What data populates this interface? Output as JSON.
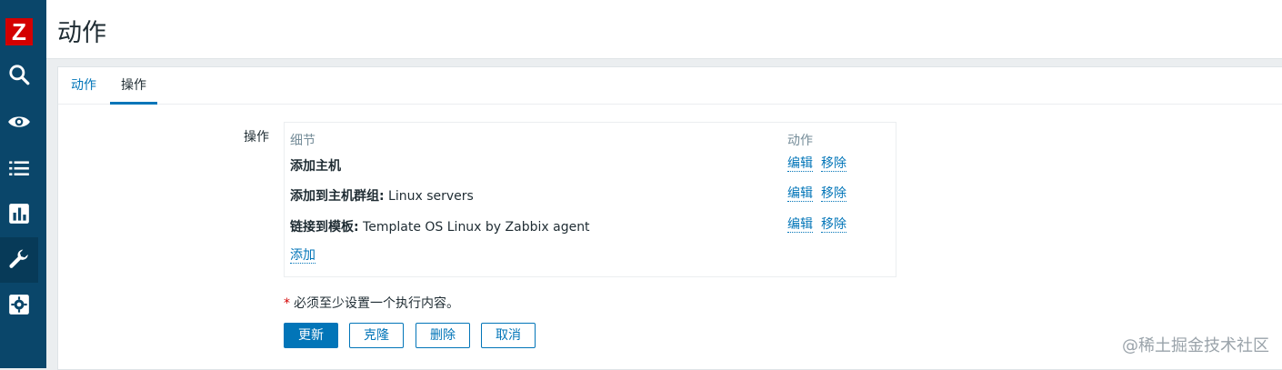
{
  "app": {
    "logo_letter": "Z",
    "brand_color": "#d40000",
    "sidebar_color": "#0a466a",
    "accent": "#0275b8"
  },
  "page": {
    "title": "动作"
  },
  "sidebar": {
    "icons": [
      "search-icon",
      "eye-icon",
      "list-icon",
      "bar-chart-icon",
      "wrench-icon",
      "gear-icon"
    ],
    "active": "wrench-icon"
  },
  "tabs": [
    {
      "label": "动作",
      "active": false
    },
    {
      "label": "操作",
      "active": true
    }
  ],
  "operations": {
    "field_label": "操作",
    "columns": {
      "details": "细节",
      "actions": "动作"
    },
    "rows": [
      {
        "bold": "添加主机",
        "rest": "",
        "edit": "编辑",
        "remove": "移除"
      },
      {
        "bold": "添加到主机群组:",
        "rest": " Linux servers",
        "edit": "编辑",
        "remove": "移除"
      },
      {
        "bold": "链接到模板:",
        "rest": " Template OS Linux by Zabbix agent",
        "edit": "编辑",
        "remove": "移除"
      }
    ],
    "add_link": "添加"
  },
  "required_note": {
    "star": "*",
    "text": "必须至少设置一个执行内容。"
  },
  "buttons": {
    "update": "更新",
    "clone": "克隆",
    "delete": "删除",
    "cancel": "取消"
  },
  "watermark": "@稀土掘金技术社区"
}
